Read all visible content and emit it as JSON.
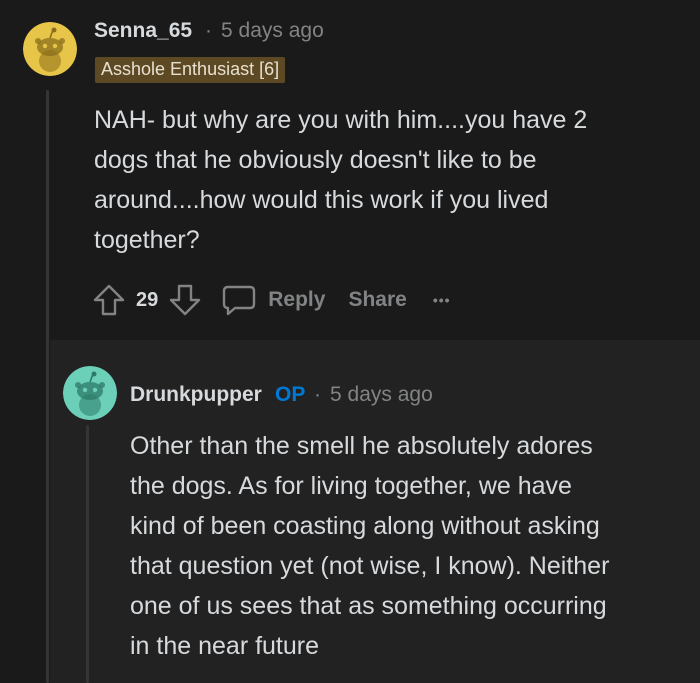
{
  "comment1": {
    "author": "Senna_65",
    "separator": "·",
    "time": "5 days ago",
    "flair": "Asshole Enthusiast [6]",
    "body_lines": [
      "NAH- but why are you with him....you have 2",
      "dogs that he obviously doesn't like to be",
      "around....how would this work if you lived",
      "together?"
    ],
    "votes": "29",
    "reply_label": "Reply",
    "share_label": "Share",
    "more_label": "•••",
    "avatar_color": "#e7c548"
  },
  "comment2": {
    "author": "Drunkpupper",
    "op_badge": "OP",
    "separator": "·",
    "time": "5 days ago",
    "body_lines": [
      "Other than the smell he absolutely adores",
      "the dogs. As for living together, we have",
      "kind of been coasting along without asking",
      "that question yet (not wise, I know). Neither",
      "one of us sees that as something occurring",
      "in the near future"
    ],
    "avatar_color": "#6cd0b8"
  },
  "colors": {
    "background": "#1a1a1b",
    "text": "#d7dadc",
    "muted": "#818384",
    "op_blue": "#0079d3",
    "flair_bg": "#5d4a25"
  }
}
